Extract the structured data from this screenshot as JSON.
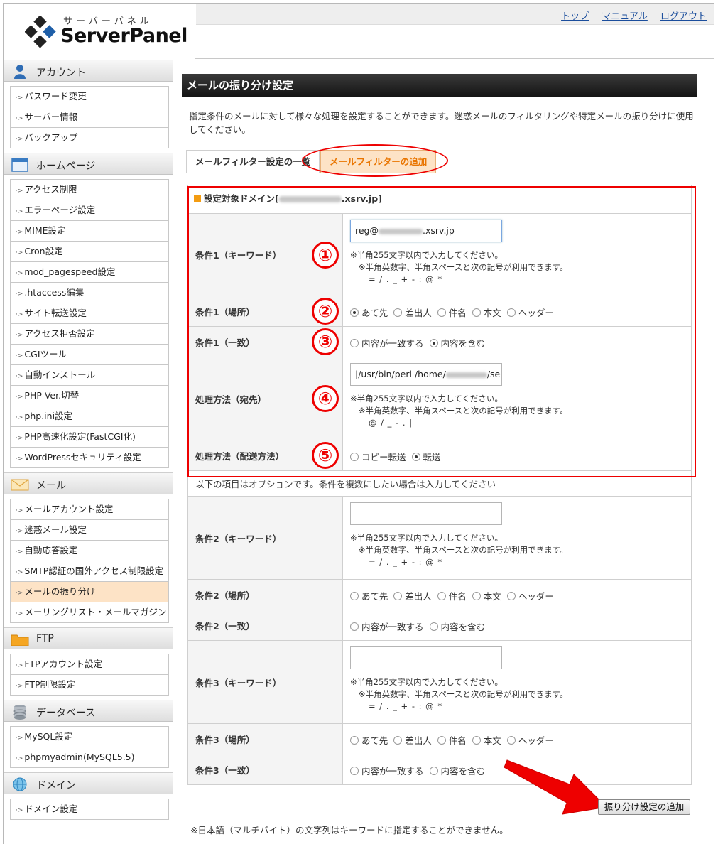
{
  "brand": {
    "kana": "サーバーパネル",
    "name": "ServerPanel"
  },
  "toplinks": [
    "トップ",
    "マニュアル",
    "ログアウト"
  ],
  "sidebar": [
    {
      "title": "アカウント",
      "icon": "user-icon",
      "items": [
        "パスワード変更",
        "サーバー情報",
        "バックアップ"
      ]
    },
    {
      "title": "ホームページ",
      "icon": "window-icon",
      "items": [
        "アクセス制限",
        "エラーページ設定",
        "MIME設定",
        "Cron設定",
        "mod_pagespeed設定",
        ".htaccess編集",
        "サイト転送設定",
        "アクセス拒否設定",
        "CGIツール",
        "自動インストール",
        "PHP Ver.切替",
        "php.ini設定",
        "PHP高速化設定(FastCGI化)",
        "WordPressセキュリティ設定"
      ]
    },
    {
      "title": "メール",
      "icon": "envelope-icon",
      "items": [
        "メールアカウント設定",
        "迷惑メール設定",
        "自動応答設定",
        "SMTP認証の国外アクセス制限設定",
        "メールの振り分け",
        "メーリングリスト・メールマガジン"
      ],
      "active": 4
    },
    {
      "title": "FTP",
      "icon": "folder-icon",
      "items": [
        "FTPアカウント設定",
        "FTP制限設定"
      ]
    },
    {
      "title": "データベース",
      "icon": "database-icon",
      "items": [
        "MySQL設定",
        "phpmyadmin(MySQL5.5)"
      ]
    },
    {
      "title": "ドメイン",
      "icon": "globe-icon",
      "items": [
        "ドメイン設定"
      ]
    }
  ],
  "page": {
    "title": "メールの振り分け設定",
    "description": "指定条件のメールに対して様々な処理を設定することができます。迷惑メールのフィルタリングや特定メールの振り分けに使用してください。",
    "tabs": [
      "メールフィルター設定の一覧",
      "メールフィルターの追加"
    ]
  },
  "form": {
    "domain_label": "設定対象ドメイン[",
    "domain_value": ".xsrv.jp]",
    "note_line1": "※半角255文字以内で入力してください。",
    "note_line2": "※半角英数字、半角スペースと次の記号が利用できます。",
    "symbols_keyword": "= / . _ + - : @ *",
    "symbols_path": "@ / _ - . |",
    "place_options": [
      "あて先",
      "差出人",
      "件名",
      "本文",
      "ヘッダー"
    ],
    "match_options": [
      "内容が一致する",
      "内容を含む"
    ],
    "delivery_options": [
      "コピー転送",
      "転送"
    ],
    "cond1_keyword_label": "条件1（キーワード）",
    "cond1_keyword_value": "reg@",
    "cond1_keyword_suffix": ".xsrv.jp",
    "cond1_place_label": "条件1（場所）",
    "cond1_match_label": "条件1（一致）",
    "dest_label": "処理方法（宛先）",
    "dest_value": "|/usr/bin/perl /home/",
    "dest_suffix": "/see",
    "delivery_label": "処理方法（配送方法）",
    "option_note": "以下の項目はオプションです。条件を複数にしたい場合は入力してください",
    "cond2_keyword_label": "条件2（キーワード）",
    "cond2_place_label": "条件2（場所）",
    "cond2_match_label": "条件2（一致）",
    "cond3_keyword_label": "条件3（キーワード）",
    "cond3_place_label": "条件3（場所）",
    "cond3_match_label": "条件3（一致）",
    "submit": "振り分け設定の追加",
    "footnote": "※日本語（マルチバイト）の文字列はキーワードに指定することができません。"
  },
  "annotations": [
    "①",
    "②",
    "③",
    "④",
    "⑤"
  ],
  "colors": {
    "annotation": "#e00000",
    "active_tab": "#e97500",
    "active_bg": "#fde3c6"
  }
}
